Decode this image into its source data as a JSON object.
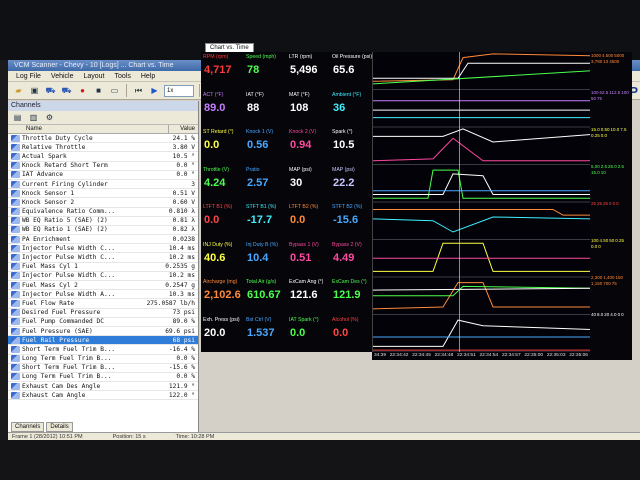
{
  "window": {
    "title": "VCM Scanner - Chevy - 10 [Logs] ... Chart vs. Time"
  },
  "menu": [
    "Log File",
    "Vehicle",
    "Layout",
    "Tools",
    "Help"
  ],
  "toolbar": {
    "playback_speed": "1x",
    "brand": "HP"
  },
  "channels_panel": {
    "title": "Channels",
    "col_name": "Name",
    "col_value": "Value",
    "tabs": [
      "Channels",
      "Details"
    ]
  },
  "channels": [
    {
      "name": "Throttle Duty Cycle",
      "value": "24.1 %"
    },
    {
      "name": "Relative Throttle",
      "value": "3.80 V"
    },
    {
      "name": "Actual Spark",
      "value": "10.5 °"
    },
    {
      "name": "Knock Retard Short Term",
      "value": "0.0 °"
    },
    {
      "name": "IAT Advance",
      "value": "0.0 °"
    },
    {
      "name": "Current Firing Cylinder",
      "value": "3"
    },
    {
      "name": "Knock Sensor 1",
      "value": "0.51 V"
    },
    {
      "name": "Knock Sensor 2",
      "value": "0.60 V"
    },
    {
      "name": "Equivalence Ratio Comm...",
      "value": "0.810 λ"
    },
    {
      "name": "WB EQ Ratio 5 (SAE) (2)",
      "value": "0.81 λ"
    },
    {
      "name": "WB EQ Ratio 1 (SAE) (2)",
      "value": "0.82 λ"
    },
    {
      "name": "PA Enrichment",
      "value": "0.0238"
    },
    {
      "name": "Injector Pulse Width C...",
      "value": "10.4 ms"
    },
    {
      "name": "Injector Pulse Width C...",
      "value": "10.2 ms"
    },
    {
      "name": "Fuel Mass Cyl 1",
      "value": "0.2535 g"
    },
    {
      "name": "Injector Pulse Width C...",
      "value": "10.2 ms"
    },
    {
      "name": "Fuel Mass Cyl 2",
      "value": "0.2547 g"
    },
    {
      "name": "Injector Pulse Width A...",
      "value": "10.3 ms"
    },
    {
      "name": "Fuel Flow Rate",
      "value": "275.0587 lb/h"
    },
    {
      "name": "Desired Fuel Pressure",
      "value": "73 psi"
    },
    {
      "name": "Fuel Pump Commanded DC",
      "value": "89.0 %"
    },
    {
      "name": "Fuel Pressure (SAE)",
      "value": "69.6 psi"
    },
    {
      "name": "Fuel Rail Pressure",
      "value": "68 psi",
      "selected": true
    },
    {
      "name": "Short Term Fuel Trim B...",
      "value": "-16.4 %"
    },
    {
      "name": "Long Term Fuel Trim B...",
      "value": "0.0 %"
    },
    {
      "name": "Short Term Fuel Trim B...",
      "value": "-15.6 %"
    },
    {
      "name": "Long Term Fuel Trim B...",
      "value": "0.0 %"
    },
    {
      "name": "Exhaust Cam Des Angle",
      "value": "121.9 °"
    },
    {
      "name": "Exhaust Cam Angle",
      "value": "122.0 °"
    }
  ],
  "chart_tab": "Chart vs. Time",
  "gauge_rows": [
    [
      {
        "label": "RPM (rpm)",
        "value": "4,717",
        "color": "#ff3a3a"
      },
      {
        "label": "Speed (mph)",
        "value": "78",
        "color": "#4cff4c"
      },
      {
        "label": "LTR (rpm)",
        "value": "5,496",
        "color": "#ffffff"
      },
      {
        "label": "Oil Pressure (psi)",
        "value": "65.6",
        "color": "#ffffff"
      }
    ],
    [
      {
        "label": "ACT (°F)",
        "value": "89.0",
        "color": "#c77dff"
      },
      {
        "label": "IAT (°F)",
        "value": "88",
        "color": "#ffffff"
      },
      {
        "label": "MAT (°F)",
        "value": "108",
        "color": "#ffffff"
      },
      {
        "label": "Ambient (°F)",
        "value": "36",
        "color": "#3ff0ff"
      }
    ],
    [
      {
        "label": "ST Retard (°)",
        "value": "0.0",
        "color": "#ffff44"
      },
      {
        "label": "Knock 1 (V)",
        "value": "0.56",
        "color": "#4aa8ff"
      },
      {
        "label": "Knock 2 (V)",
        "value": "0.94",
        "color": "#ff4aa0"
      },
      {
        "label": "Spark (°)",
        "value": "10.5",
        "color": "#ffffff"
      }
    ],
    [
      {
        "label": "Throttle (V)",
        "value": "4.24",
        "color": "#4cff4c"
      },
      {
        "label": "Pratio",
        "value": "2.57",
        "color": "#4aa8ff"
      },
      {
        "label": "MAP (psi)",
        "value": "30",
        "color": "#ffffff"
      },
      {
        "label": "MAP (psi)",
        "value": "22.2",
        "color": "#c8c8ff"
      }
    ],
    [
      {
        "label": "LTFT B1 (%)",
        "value": "0.0",
        "color": "#ff4444"
      },
      {
        "label": "STFT B1 (%)",
        "value": "-17.7",
        "color": "#3ff0ff"
      },
      {
        "label": "LTFT B2 (%)",
        "value": "0.0",
        "color": "#ff8a3a"
      },
      {
        "label": "STFT B2 (%)",
        "value": "-15.6",
        "color": "#4aa8ff"
      }
    ],
    [
      {
        "label": "INJ Duty (%)",
        "value": "40.6",
        "color": "#ffff44"
      },
      {
        "label": "Inj Duty B (%)",
        "value": "10.4",
        "color": "#4aa8ff"
      },
      {
        "label": "Bypass 1 (V)",
        "value": "0.51",
        "color": "#ff4aa0"
      },
      {
        "label": "Bypass 2 (V)",
        "value": "4.49",
        "color": "#ff4aa0"
      }
    ],
    [
      {
        "label": "Aircharge (mg)",
        "value": "2,102.6",
        "color": "#ff8a3a"
      },
      {
        "label": "Total Air (g/s)",
        "value": "610.67",
        "color": "#4cff4c"
      },
      {
        "label": "ExCam Ang (°)",
        "value": "121.6",
        "color": "#ffffff"
      },
      {
        "label": "ExCam Des (°)",
        "value": "121.9",
        "color": "#4cff4c"
      }
    ],
    [
      {
        "label": "Exh. Press (psi)",
        "value": "20.0",
        "color": "#ffffff"
      },
      {
        "label": "Bst Ctrl (V)",
        "value": "1.537",
        "color": "#4aa8ff"
      },
      {
        "label": "IAT Spark (°)",
        "value": "0.0",
        "color": "#4cff4c"
      },
      {
        "label": "Alcohol (%)",
        "value": "0.0",
        "color": "#ff4444"
      }
    ]
  ],
  "time_ticks": [
    "34:39",
    "22:34:42",
    "22:34:45",
    "22:34:48",
    "22:34:51",
    "22:34:54",
    "22:34:57",
    "22:35:00",
    "22:35:03",
    "22:35:06"
  ],
  "scale_rows": [
    [
      "1000",
      "4.500",
      "5000",
      "3,780",
      "13",
      "4500"
    ],
    [
      "100",
      "62.5",
      "112.5",
      "100",
      "50",
      "75"
    ],
    [
      "15.0",
      "0.50",
      "10.0",
      "7.5",
      "0.25",
      "0.0"
    ],
    [
      "5.00",
      "2.5",
      "25.0",
      "2.5",
      "15.0",
      "10"
    ],
    [
      "25",
      "25",
      "25",
      "0",
      "0",
      "0"
    ],
    [
      "100",
      "4.50",
      "50",
      "0.25",
      "0.0",
      "0"
    ],
    [
      "2,300",
      "1,400",
      "150",
      "1,150",
      "700",
      "75"
    ],
    [
      "40",
      "8.0",
      "20",
      "4.0",
      "0",
      "0"
    ]
  ],
  "status": {
    "left": "Frame 1 (28/2012) 10:51 PM",
    "mid": "Position: 15 s",
    "right": "Time: 10:28 PM"
  }
}
